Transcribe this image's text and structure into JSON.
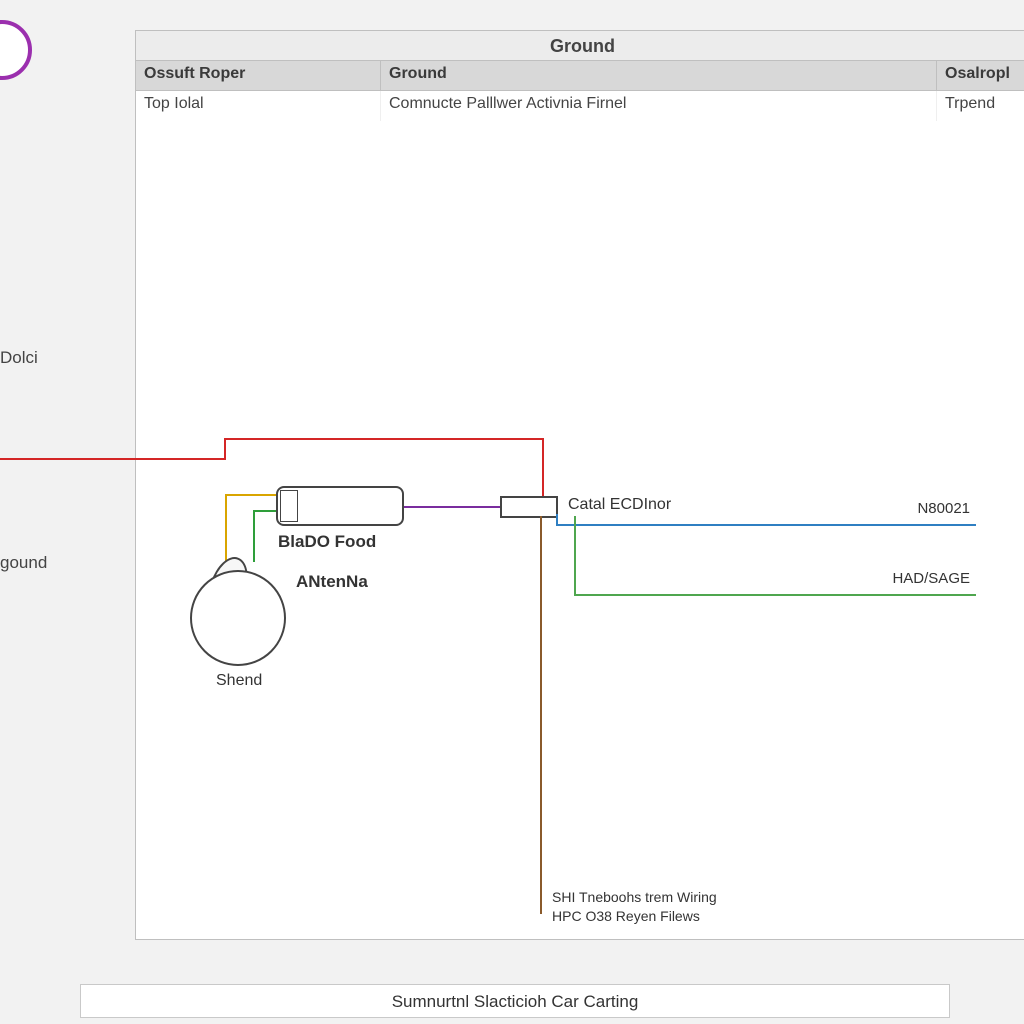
{
  "panel": {
    "title": "Ground",
    "columns": [
      "Ossuft Roper",
      "Ground",
      "Osalropl"
    ],
    "row": [
      "Top Iolal",
      "Comnucte Palllwer Activnia Firnel",
      "Trpend"
    ]
  },
  "sidebar": {
    "item1": "Dolci",
    "item2": "gound"
  },
  "diagram": {
    "blado": "BlaDO Food",
    "antenna": "ANtenNa",
    "shend": "Shend",
    "catal": "Catal ECDInor",
    "wire_n": "N80021",
    "wire_had": "HAD/SAGE",
    "footer_line1": "SHI Tneboohs trem Wiring",
    "footer_line2": "HPC O38 Reyen Filews"
  },
  "bottom_tab": "Sumnurtnl Slacticioh Car Carting",
  "colors": {
    "red": "#d42626",
    "yellow": "#d9a500",
    "green": "#2e9e3a",
    "purple": "#7a2d9e",
    "blue": "#2f7fc2",
    "brown": "#8a5a2b",
    "green2": "#4fa64f",
    "accent_purple": "#9b2fae"
  }
}
